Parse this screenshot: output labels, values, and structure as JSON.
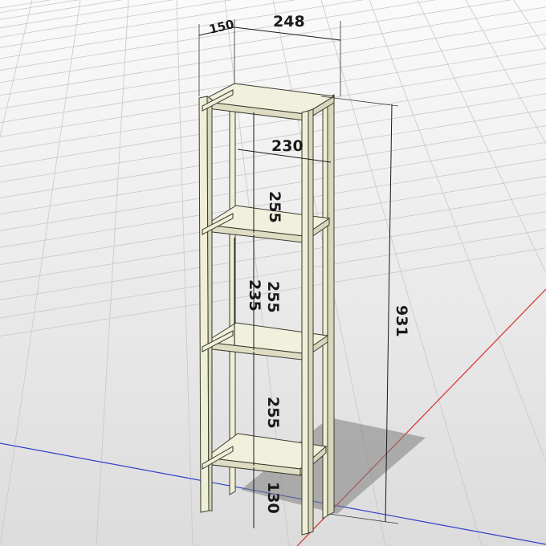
{
  "dimensions": {
    "depth": "150",
    "width": "248",
    "inner_width": "230",
    "shelf_gap_1": "255",
    "shelf_gap_2": "255",
    "shelf_gap_2_alt": "235",
    "shelf_gap_3": "255",
    "bottom_clearance": "130",
    "total_height": "931"
  },
  "colors": {
    "background": "#ffffff",
    "grid": "#c8c8c8",
    "floor": "#e4e4e4",
    "wood": "#efeed6",
    "x_axis": "#d83030",
    "z_axis": "#3040c8",
    "shadow": "#8a8a8a"
  }
}
